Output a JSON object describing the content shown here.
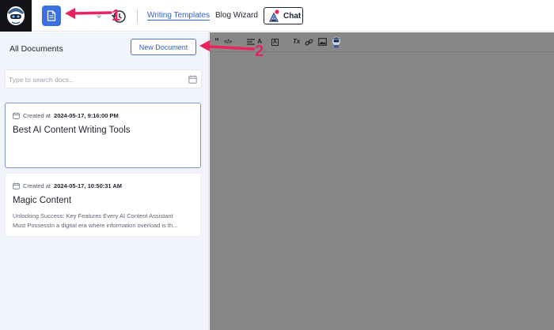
{
  "topbar": {
    "nav": {
      "writing_templates": "Writing Templates",
      "blog_wizard": "Blog Wizard"
    },
    "chat_label": "Chat"
  },
  "annotations": {
    "one": "1",
    "two": "2"
  },
  "sidebar": {
    "title": "All Documents",
    "new_document": "New Document",
    "search_placeholder": "Type to search docs...",
    "cards": [
      {
        "created_prefix": "Created at",
        "created": "2024-05-17, 9:16:00 PM",
        "title": "Best AI Content Writing Tools",
        "excerpt": [
          "",
          ""
        ],
        "selected": true
      },
      {
        "created_prefix": "Created at",
        "created": "2024-05-17, 10:50:31 AM",
        "title": "Magic Content",
        "excerpt": [
          "Unlocking Success: Key Features Every AI Content Assistant",
          "Must PossessIn a digital era where information overload is th..."
        ],
        "selected": false
      }
    ]
  },
  "editor": {
    "toolbar": [
      "quote-icon",
      "code-icon",
      "align-icon",
      "font-size-icon",
      "font-color-icon",
      "clear-format-icon",
      "link-icon",
      "image-icon",
      "robot-icon"
    ],
    "toolbar_glyphs": {
      "quote": "”",
      "code": "</>",
      "font_size": "A",
      "font_bg": "A",
      "clear_format": "Tx"
    },
    "background": "#878787"
  },
  "colors": {
    "accent": "#3c6fe0",
    "link": "#2f62d8",
    "annotation": "#e8235e",
    "sidebar_bg": "#f1f4fa",
    "logo_bg": "#121418"
  }
}
